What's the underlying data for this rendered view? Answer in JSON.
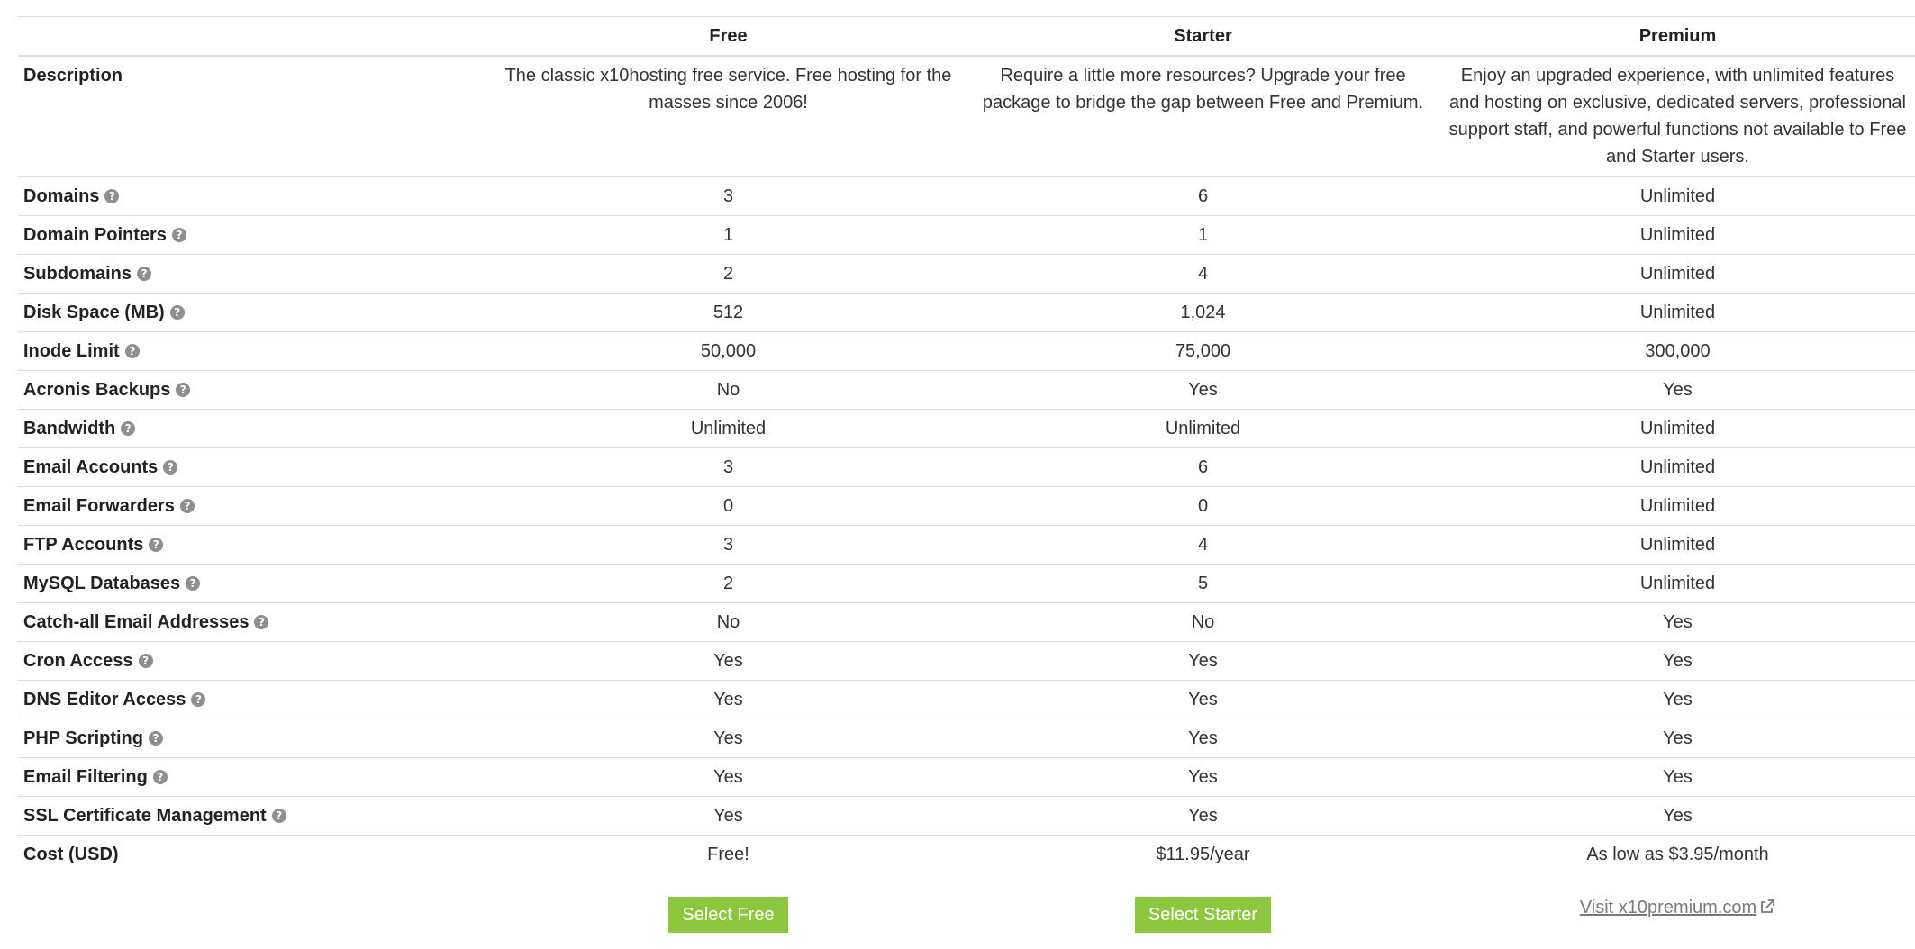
{
  "columns": {
    "label": "",
    "free": "Free",
    "starter": "Starter",
    "premium": "Premium"
  },
  "description": {
    "label": "Description",
    "free": "The classic x10hosting free service. Free hosting for the masses since 2006!",
    "starter": "Require a little more resources? Upgrade your free package to bridge the gap between Free and Premium.",
    "premium": "Enjoy an upgraded experience, with unlimited features and hosting on exclusive, dedicated servers, professional support staff, and powerful functions not available to Free and Starter users."
  },
  "rows": [
    {
      "label": "Domains",
      "help": "?",
      "free": "3",
      "starter": "6",
      "premium": "Unlimited"
    },
    {
      "label": "Domain Pointers",
      "help": "?",
      "free": "1",
      "starter": "1",
      "premium": "Unlimited"
    },
    {
      "label": "Subdomains",
      "help": "?",
      "free": "2",
      "starter": "4",
      "premium": "Unlimited"
    },
    {
      "label": "Disk Space (MB)",
      "help": "?",
      "free": "512",
      "starter": "1,024",
      "premium": "Unlimited"
    },
    {
      "label": "Inode Limit",
      "help": "?",
      "free": "50,000",
      "starter": "75,000",
      "premium": "300,000"
    },
    {
      "label": "Acronis Backups",
      "help": "?",
      "free": "No",
      "starter": "Yes",
      "premium": "Yes"
    },
    {
      "label": "Bandwidth",
      "help": "?",
      "free": "Unlimited",
      "starter": "Unlimited",
      "premium": "Unlimited"
    },
    {
      "label": "Email Accounts",
      "help": "?",
      "free": "3",
      "starter": "6",
      "premium": "Unlimited"
    },
    {
      "label": "Email Forwarders",
      "help": "?",
      "free": "0",
      "starter": "0",
      "premium": "Unlimited"
    },
    {
      "label": "FTP Accounts",
      "help": "?",
      "free": "3",
      "starter": "4",
      "premium": "Unlimited"
    },
    {
      "label": "MySQL Databases",
      "help": "?",
      "free": "2",
      "starter": "5",
      "premium": "Unlimited"
    },
    {
      "label": "Catch-all Email Addresses",
      "help": "?",
      "free": "No",
      "starter": "No",
      "premium": "Yes"
    },
    {
      "label": "Cron Access",
      "help": "?",
      "free": "Yes",
      "starter": "Yes",
      "premium": "Yes"
    },
    {
      "label": "DNS Editor Access",
      "help": "?",
      "free": "Yes",
      "starter": "Yes",
      "premium": "Yes"
    },
    {
      "label": "PHP Scripting",
      "help": "?",
      "free": "Yes",
      "starter": "Yes",
      "premium": "Yes"
    },
    {
      "label": "Email Filtering",
      "help": "?",
      "free": "Yes",
      "starter": "Yes",
      "premium": "Yes"
    },
    {
      "label": "SSL Certificate Management",
      "help": "?",
      "free": "Yes",
      "starter": "Yes",
      "premium": "Yes"
    }
  ],
  "cost": {
    "label": "Cost (USD)",
    "free": "Free!",
    "starter": "$11.95/year",
    "premium": "As low as $3.95/month"
  },
  "actions": {
    "free_button": "Select Free",
    "starter_button": "Select Starter",
    "premium_link": "Visit x10premium.com",
    "premium_link_icon": "external-link-icon"
  },
  "colors": {
    "button_bg": "#8cc83e",
    "button_text": "#ffffff",
    "help_icon": "#8f8f8f",
    "border": "#dddddd",
    "link": "#7a7a7a"
  }
}
